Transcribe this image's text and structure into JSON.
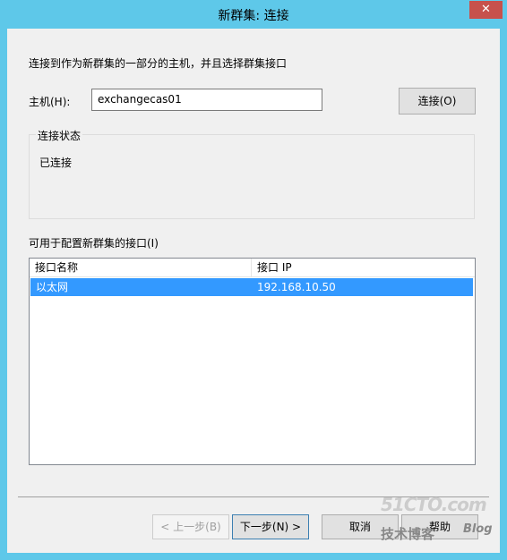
{
  "window": {
    "title": "新群集: 连接",
    "close_glyph": "✕"
  },
  "instruction": "连接到作为新群集的一部分的主机，并且选择群集接口",
  "host": {
    "label": "主机(H):",
    "value": "exchangecas01"
  },
  "connect_button": "连接(O)",
  "status_group": {
    "title": "连接状态",
    "text": "已连接"
  },
  "interfaces": {
    "label": "可用于配置新群集的接口(I)",
    "columns": [
      "接口名称",
      "接口 IP"
    ],
    "rows": [
      {
        "name": "以太网",
        "ip": "192.168.10.50"
      }
    ]
  },
  "buttons": {
    "back": "< 上一步(B)",
    "next": "下一步(N) >",
    "cancel": "取消",
    "help": "帮助"
  },
  "watermark": {
    "top": "51CTO.com",
    "bottom": "技术博客",
    "blog": "Blog"
  },
  "colors": {
    "titlebar": "#5ec8e9",
    "selection": "#3399ff",
    "close": "#c7514c"
  }
}
